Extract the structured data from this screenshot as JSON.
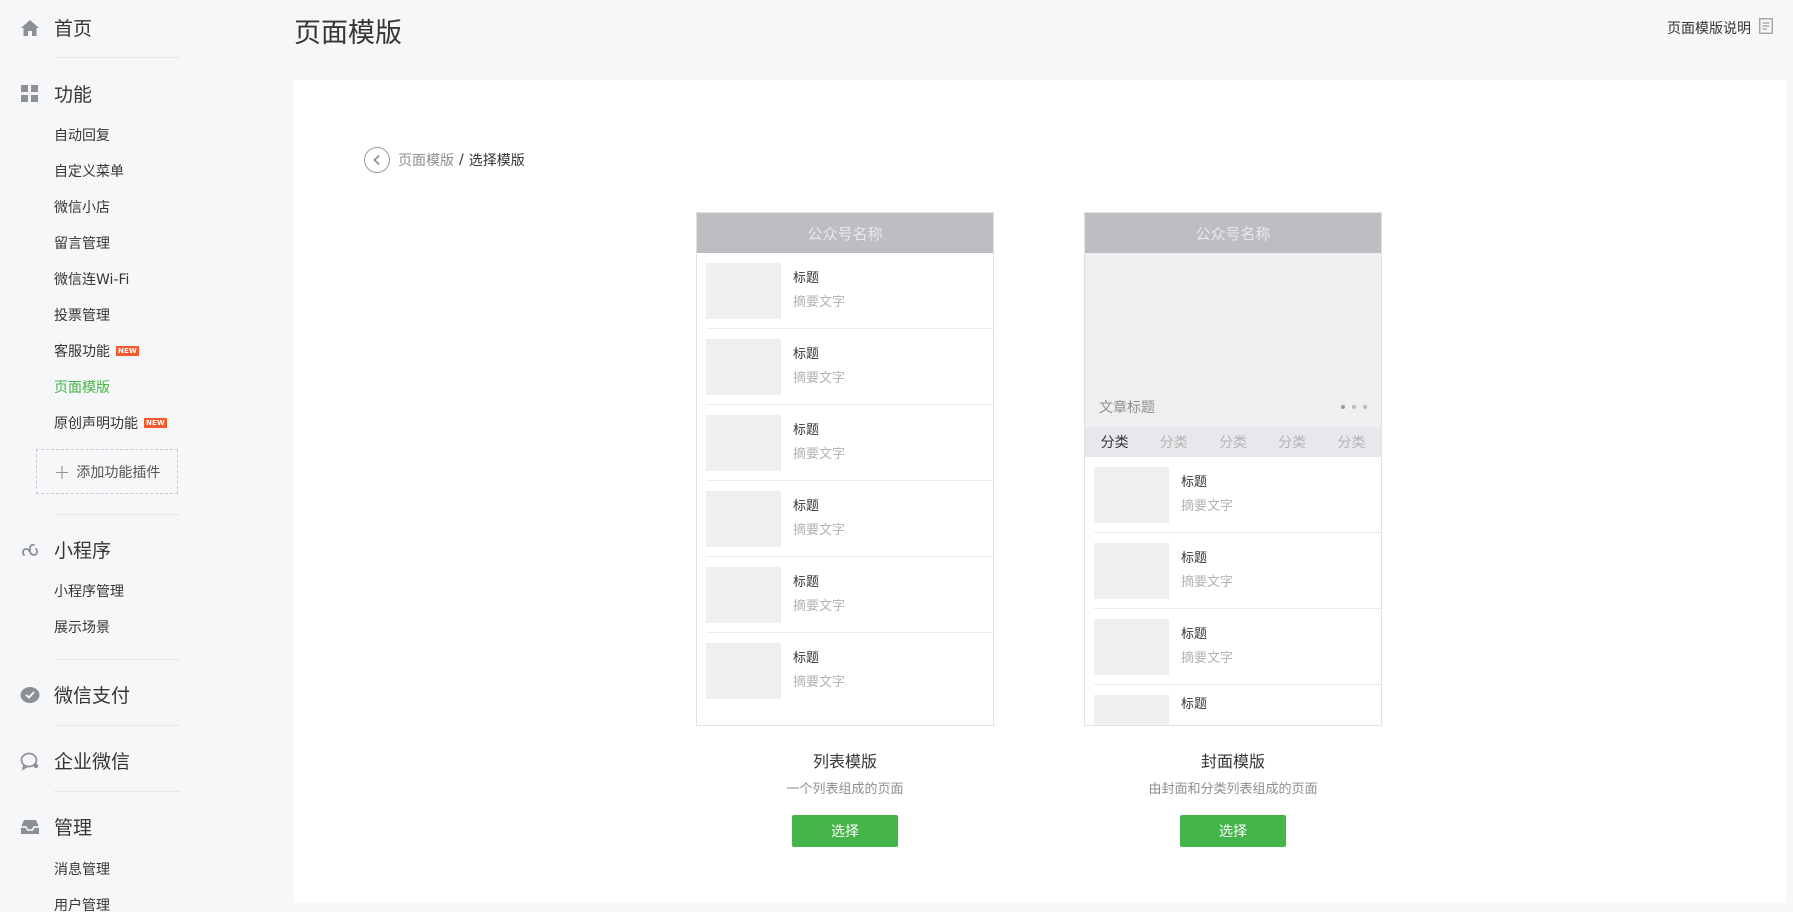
{
  "sidebar": {
    "home": "首页",
    "features": {
      "title": "功能",
      "items": [
        "自动回复",
        "自定义菜单",
        "微信小店",
        "留言管理",
        "微信连Wi-Fi",
        "投票管理",
        "客服功能",
        "页面模版",
        "原创声明功能"
      ],
      "badge": "NEW",
      "add_plugin": "添加功能插件"
    },
    "miniprogram": {
      "title": "小程序",
      "items": [
        "小程序管理",
        "展示场景"
      ]
    },
    "pay": "微信支付",
    "work": "企业微信",
    "manage": {
      "title": "管理",
      "items": [
        "消息管理",
        "用户管理"
      ]
    }
  },
  "header": {
    "title": "页面模版",
    "help": "页面模版说明"
  },
  "breadcrumb": {
    "parent": "页面模版",
    "separator": "/",
    "current": "选择模版"
  },
  "templates": {
    "list": {
      "account_name": "公众号名称",
      "row_title": "标题",
      "row_summary": "摘要文字",
      "name": "列表模版",
      "desc": "一个列表组成的页面",
      "button": "选择"
    },
    "cover": {
      "account_name": "公众号名称",
      "cover_title": "文章标题",
      "categories": [
        "分类",
        "分类",
        "分类",
        "分类",
        "分类"
      ],
      "row_title": "标题",
      "row_summary": "摘要文字",
      "name": "封面模版",
      "desc": "由封面和分类列表组成的页面",
      "button": "选择"
    }
  },
  "colors": {
    "accent": "#44b549",
    "badge": "#f35a2c"
  }
}
